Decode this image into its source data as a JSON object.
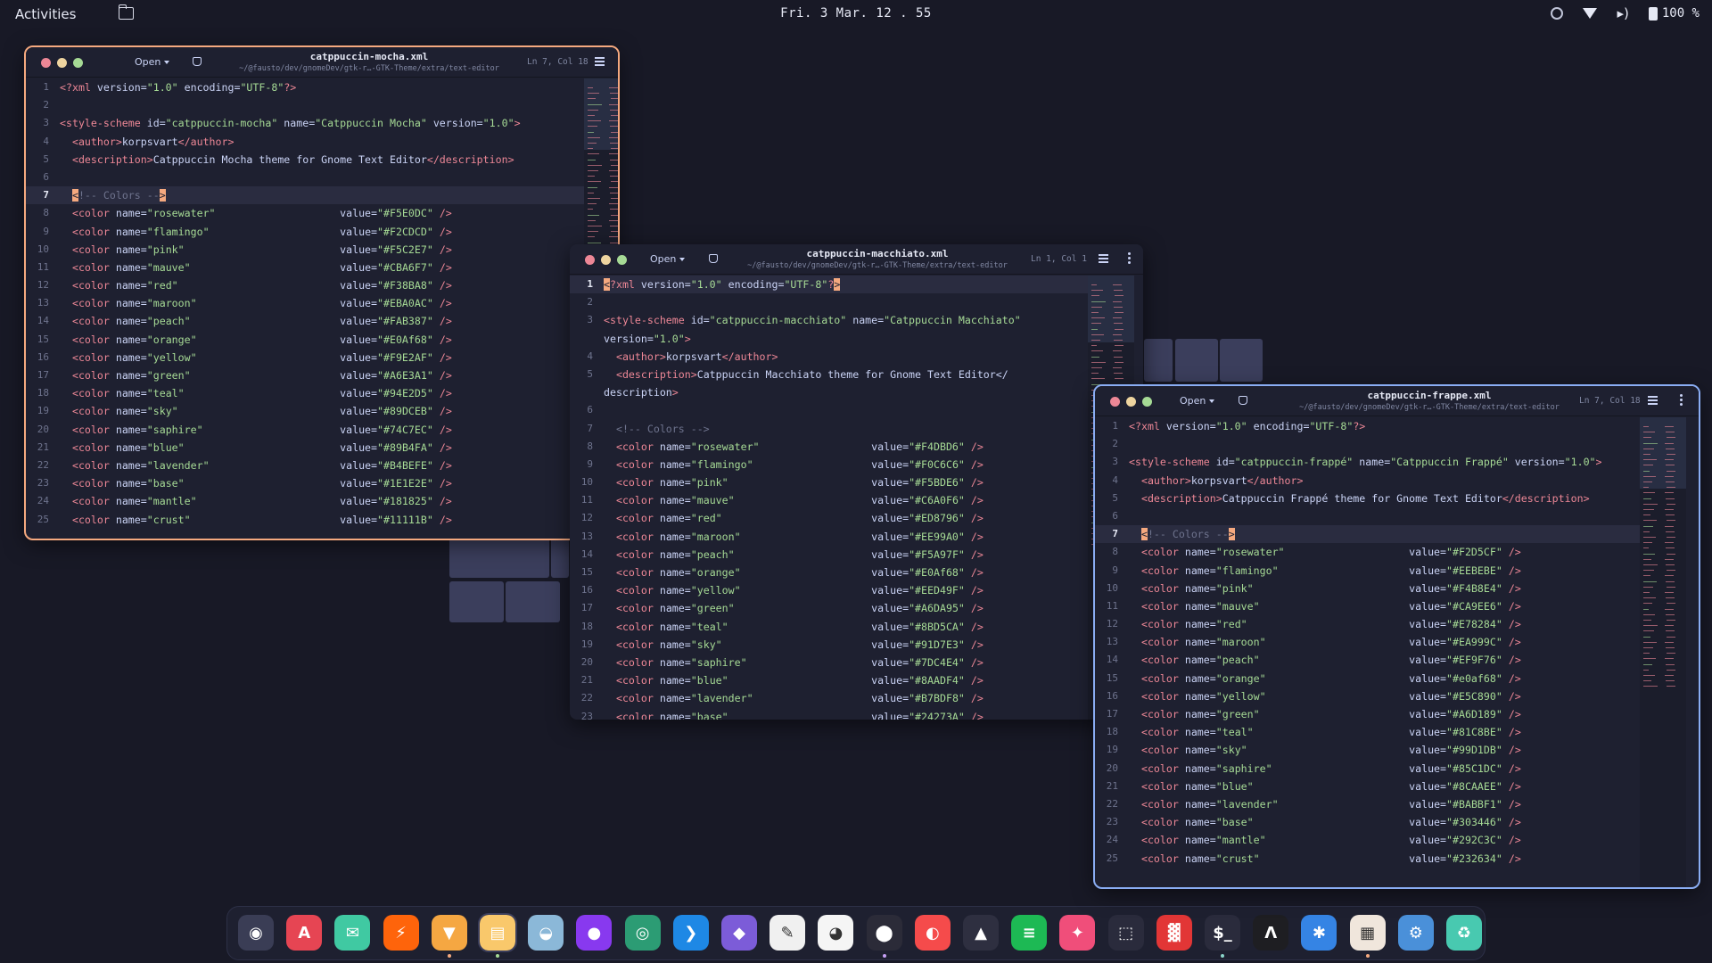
{
  "topbar": {
    "activities": "Activities",
    "clock": "Fri. 3 Mar.  12 . 55",
    "battery": "100 %"
  },
  "windows": [
    {
      "id": "mocha",
      "title": "catppuccin-mocha.xml",
      "subtitle": "~/@fausto/dev/gnomeDev/gtk-r…-GTK-Theme/extra/text-editor",
      "open_label": "Open",
      "cursor_pos": "Ln 7, Col 18",
      "accent": "#f5a97f",
      "current_line": 7,
      "lines": [
        "<?xml version=\"1.0\" encoding=\"UTF-8\"?>",
        "",
        "<style-scheme id=\"catppuccin-mocha\" name=\"Catppuccin Mocha\" version=\"1.0\">",
        "  <author>korpsvart</author>",
        "  <description>Catppuccin Mocha theme for Gnome Text Editor</description>",
        "",
        "  <!-- Colors -->",
        "  <color name=\"rosewater\"                    value=\"#F5E0DC\" />",
        "  <color name=\"flamingo\"                     value=\"#F2CDCD\" />",
        "  <color name=\"pink\"                         value=\"#F5C2E7\" />",
        "  <color name=\"mauve\"                        value=\"#CBA6F7\" />",
        "  <color name=\"red\"                          value=\"#F38BA8\" />",
        "  <color name=\"maroon\"                       value=\"#EBA0AC\" />",
        "  <color name=\"peach\"                        value=\"#FAB387\" />",
        "  <color name=\"orange\"                       value=\"#E0Af68\" />",
        "  <color name=\"yellow\"                       value=\"#F9E2AF\" />",
        "  <color name=\"green\"                        value=\"#A6E3A1\" />",
        "  <color name=\"teal\"                         value=\"#94E2D5\" />",
        "  <color name=\"sky\"                          value=\"#89DCEB\" />",
        "  <color name=\"saphire\"                      value=\"#74C7EC\" />",
        "  <color name=\"blue\"                         value=\"#89B4FA\" />",
        "  <color name=\"lavender\"                     value=\"#B4BEFE\" />",
        "  <color name=\"base\"                         value=\"#1E1E2E\" />",
        "  <color name=\"mantle\"                       value=\"#181825\" />",
        "  <color name=\"crust\"                        value=\"#11111B\" />"
      ]
    },
    {
      "id": "macchiato",
      "title": "catppuccin-macchiato.xml",
      "subtitle": "~/@fausto/dev/gnomeDev/gtk-r…-GTK-Theme/extra/text-editor",
      "open_label": "Open",
      "cursor_pos": "Ln 1, Col 1",
      "accent": "#f5a97f",
      "current_line": 1,
      "lines": [
        "<?xml version=\"1.0\" encoding=\"UTF-8\"?>",
        "",
        "<style-scheme id=\"catppuccin-macchiato\" name=\"Catppuccin Macchiato\"",
        "version=\"1.0\">",
        "  <author>korpsvart</author>",
        "  <description>Catppuccin Macchiato theme for Gnome Text Editor</",
        "description>",
        "",
        "  <!-- Colors -->",
        "  <color name=\"rosewater\"                  value=\"#F4DBD6\" />",
        "  <color name=\"flamingo\"                   value=\"#F0C6C6\" />",
        "  <color name=\"pink\"                       value=\"#F5BDE6\" />",
        "  <color name=\"mauve\"                      value=\"#C6A0F6\" />",
        "  <color name=\"red\"                        value=\"#ED8796\" />",
        "  <color name=\"maroon\"                     value=\"#EE99A0\" />",
        "  <color name=\"peach\"                      value=\"#F5A97F\" />",
        "  <color name=\"orange\"                     value=\"#E0Af68\" />",
        "  <color name=\"yellow\"                     value=\"#EED49F\" />",
        "  <color name=\"green\"                      value=\"#A6DA95\" />",
        "  <color name=\"teal\"                       value=\"#8BD5CA\" />",
        "  <color name=\"sky\"                        value=\"#91D7E3\" />",
        "  <color name=\"saphire\"                    value=\"#7DC4E4\" />",
        "  <color name=\"blue\"                       value=\"#8AADF4\" />",
        "  <color name=\"lavender\"                   value=\"#B7BDF8\" />",
        "  <color name=\"base\"                       value=\"#24273A\" />"
      ],
      "line_numbers": [
        "1",
        "2",
        "3",
        "",
        "4",
        "5",
        "",
        "6",
        "7",
        "8",
        "9",
        "10",
        "11",
        "12",
        "13",
        "14",
        "15",
        "16",
        "17",
        "18",
        "19",
        "20",
        "21",
        "22",
        "23"
      ]
    },
    {
      "id": "frappe",
      "title": "catppuccin-frappe.xml",
      "subtitle": "~/@fausto/dev/gnomeDev/gtk-r…-GTK-Theme/extra/text-editor",
      "open_label": "Open",
      "cursor_pos": "Ln 7, Col 18",
      "accent": "#8aadf4",
      "current_line": 7,
      "lines": [
        "<?xml version=\"1.0\" encoding=\"UTF-8\"?>",
        "",
        "<style-scheme id=\"catppuccin-frappé\" name=\"Catppuccin Frappé\" version=\"1.0\">",
        "  <author>korpsvart</author>",
        "  <description>Catppuccin Frappé theme for Gnome Text Editor</description>",
        "",
        "  <!-- Colors -->",
        "  <color name=\"rosewater\"                    value=\"#F2D5CF\" />",
        "  <color name=\"flamingo\"                     value=\"#EEBEBE\" />",
        "  <color name=\"pink\"                         value=\"#F4B8E4\" />",
        "  <color name=\"mauve\"                        value=\"#CA9EE6\" />",
        "  <color name=\"red\"                          value=\"#E78284\" />",
        "  <color name=\"maroon\"                       value=\"#EA999C\" />",
        "  <color name=\"peach\"                        value=\"#EF9F76\" />",
        "  <color name=\"orange\"                       value=\"#e0af68\" />",
        "  <color name=\"yellow\"                       value=\"#E5C890\" />",
        "  <color name=\"green\"                        value=\"#A6D189\" />",
        "  <color name=\"teal\"                         value=\"#81C8BE\" />",
        "  <color name=\"sky\"                          value=\"#99D1DB\" />",
        "  <color name=\"saphire\"                      value=\"#85C1DC\" />",
        "  <color name=\"blue\"                         value=\"#8CAAEE\" />",
        "  <color name=\"lavender\"                     value=\"#BABBF1\" />",
        "  <color name=\"base\"                         value=\"#303446\" />",
        "  <color name=\"mantle\"                       value=\"#292C3C\" />",
        "  <color name=\"crust\"                        value=\"#232634\" />"
      ]
    }
  ],
  "dock": [
    {
      "name": "ghost-app-icon",
      "color": "#3a3d55",
      "glyph": "◉"
    },
    {
      "name": "app-store-icon",
      "color": "#e64553",
      "glyph": "A"
    },
    {
      "name": "mail-icon",
      "color": "#40c9a2",
      "glyph": "✉"
    },
    {
      "name": "bolt-app-icon",
      "color": "#fe640b",
      "glyph": "⚡"
    },
    {
      "name": "brave-browser-icon",
      "color": "#f5a742",
      "glyph": "▼"
    },
    {
      "name": "files-icon",
      "color": "#f9c86b",
      "glyph": "▤"
    },
    {
      "name": "disk-icon",
      "color": "#8bb8d8",
      "glyph": "◒"
    },
    {
      "name": "github-icon",
      "color": "#8839ef",
      "glyph": "●"
    },
    {
      "name": "globe-icon",
      "color": "#2c9c74",
      "glyph": "◎"
    },
    {
      "name": "vscode-icon",
      "color": "#1e88e5",
      "glyph": "❯"
    },
    {
      "name": "obsidian-icon",
      "color": "#7c5cd8",
      "glyph": "◆"
    },
    {
      "name": "text-editor-icon",
      "color": "#f0f0f0",
      "glyph": "✎"
    },
    {
      "name": "color-picker-icon",
      "color": "#f5f5f5",
      "glyph": "◕"
    },
    {
      "name": "figma-icon",
      "color": "#2b2b38",
      "glyph": "⬤"
    },
    {
      "name": "shortcuts-icon",
      "color": "#f54b4b",
      "glyph": "◐"
    },
    {
      "name": "inkscape-icon",
      "color": "#2e2f40",
      "glyph": "▲"
    },
    {
      "name": "spotify-icon",
      "color": "#1db954",
      "glyph": "≡"
    },
    {
      "name": "davinci-icon",
      "color": "#f04e7a",
      "glyph": "✦"
    },
    {
      "name": "screenshot-icon",
      "color": "#2a2b3c",
      "glyph": "⬚"
    },
    {
      "name": "waveform-icon",
      "color": "#e23636",
      "glyph": "▓"
    },
    {
      "name": "terminal-icon",
      "color": "#2a2b3c",
      "glyph": "$_"
    },
    {
      "name": "artix-icon",
      "color": "#1e1e22",
      "glyph": "Λ"
    },
    {
      "name": "extensions-icon",
      "color": "#3584e4",
      "glyph": "✱"
    },
    {
      "name": "tweaks-icon",
      "color": "#f0e6dc",
      "glyph": "▦"
    },
    {
      "name": "settings-icon",
      "color": "#4a90d9",
      "glyph": "⚙"
    },
    {
      "name": "trash-icon",
      "color": "#48c9b0",
      "glyph": "♻"
    }
  ]
}
